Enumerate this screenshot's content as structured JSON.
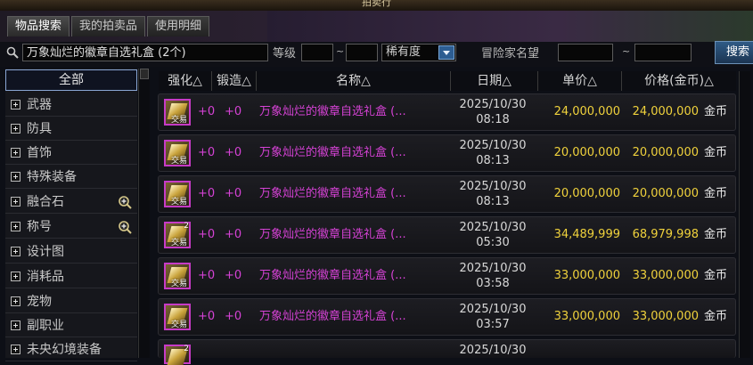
{
  "window": {
    "title": "拍卖行"
  },
  "tabs": [
    {
      "label": "物品搜索"
    },
    {
      "label": "我的拍卖品"
    },
    {
      "label": "使用明细"
    }
  ],
  "search": {
    "value": "万象灿烂的徽章自选礼盒 (2个)",
    "level_label": "等级",
    "tilde": "~",
    "rarity_label": "稀有度",
    "adventurer_label": "冒险家名望",
    "button_label": "搜索"
  },
  "sidebar": {
    "items": [
      {
        "label": "全部"
      },
      {
        "label": "武器"
      },
      {
        "label": "防具"
      },
      {
        "label": "首饰"
      },
      {
        "label": "特殊装备"
      },
      {
        "label": "融合石"
      },
      {
        "label": "称号"
      },
      {
        "label": "设计图"
      },
      {
        "label": "消耗品"
      },
      {
        "label": "宠物"
      },
      {
        "label": "副职业"
      },
      {
        "label": "未央幻境装备"
      }
    ]
  },
  "table": {
    "headers": [
      "强化△",
      "锻造△",
      "名称△",
      "日期△",
      "单价△",
      "价格(金币)△"
    ],
    "rows": [
      {
        "qty": "",
        "trade": "交易",
        "enhance": "+0",
        "forge": "+0",
        "name": "万象灿烂的徽章自选礼盒 (...",
        "date": "2025/10/30",
        "time": "08:18",
        "unit_price": "24,000,000",
        "price": "24,000,000",
        "currency": "金币"
      },
      {
        "qty": "",
        "trade": "交易",
        "enhance": "+0",
        "forge": "+0",
        "name": "万象灿烂的徽章自选礼盒 (...",
        "date": "2025/10/30",
        "time": "08:13",
        "unit_price": "20,000,000",
        "price": "20,000,000",
        "currency": "金币"
      },
      {
        "qty": "",
        "trade": "交易",
        "enhance": "+0",
        "forge": "+0",
        "name": "万象灿烂的徽章自选礼盒 (...",
        "date": "2025/10/30",
        "time": "08:13",
        "unit_price": "20,000,000",
        "price": "20,000,000",
        "currency": "金币"
      },
      {
        "qty": "2",
        "trade": "交易",
        "enhance": "+0",
        "forge": "+0",
        "name": "万象灿烂的徽章自选礼盒 (...",
        "date": "2025/10/30",
        "time": "05:30",
        "unit_price": "34,489,999",
        "price": "68,979,998",
        "currency": "金币"
      },
      {
        "qty": "",
        "trade": "交易",
        "enhance": "+0",
        "forge": "+0",
        "name": "万象灿烂的徽章自选礼盒 (...",
        "date": "2025/10/30",
        "time": "03:58",
        "unit_price": "33,000,000",
        "price": "33,000,000",
        "currency": "金币"
      },
      {
        "qty": "",
        "trade": "交易",
        "enhance": "+0",
        "forge": "+0",
        "name": "万象灿烂的徽章自选礼盒 (...",
        "date": "2025/10/30",
        "time": "03:57",
        "unit_price": "33,000,000",
        "price": "33,000,000",
        "currency": "金币"
      },
      {
        "qty": "2",
        "trade": "",
        "enhance": "",
        "forge": "",
        "name": "",
        "date": "2025/10/30",
        "time": "",
        "unit_price": "",
        "price": "",
        "currency": ""
      }
    ]
  }
}
